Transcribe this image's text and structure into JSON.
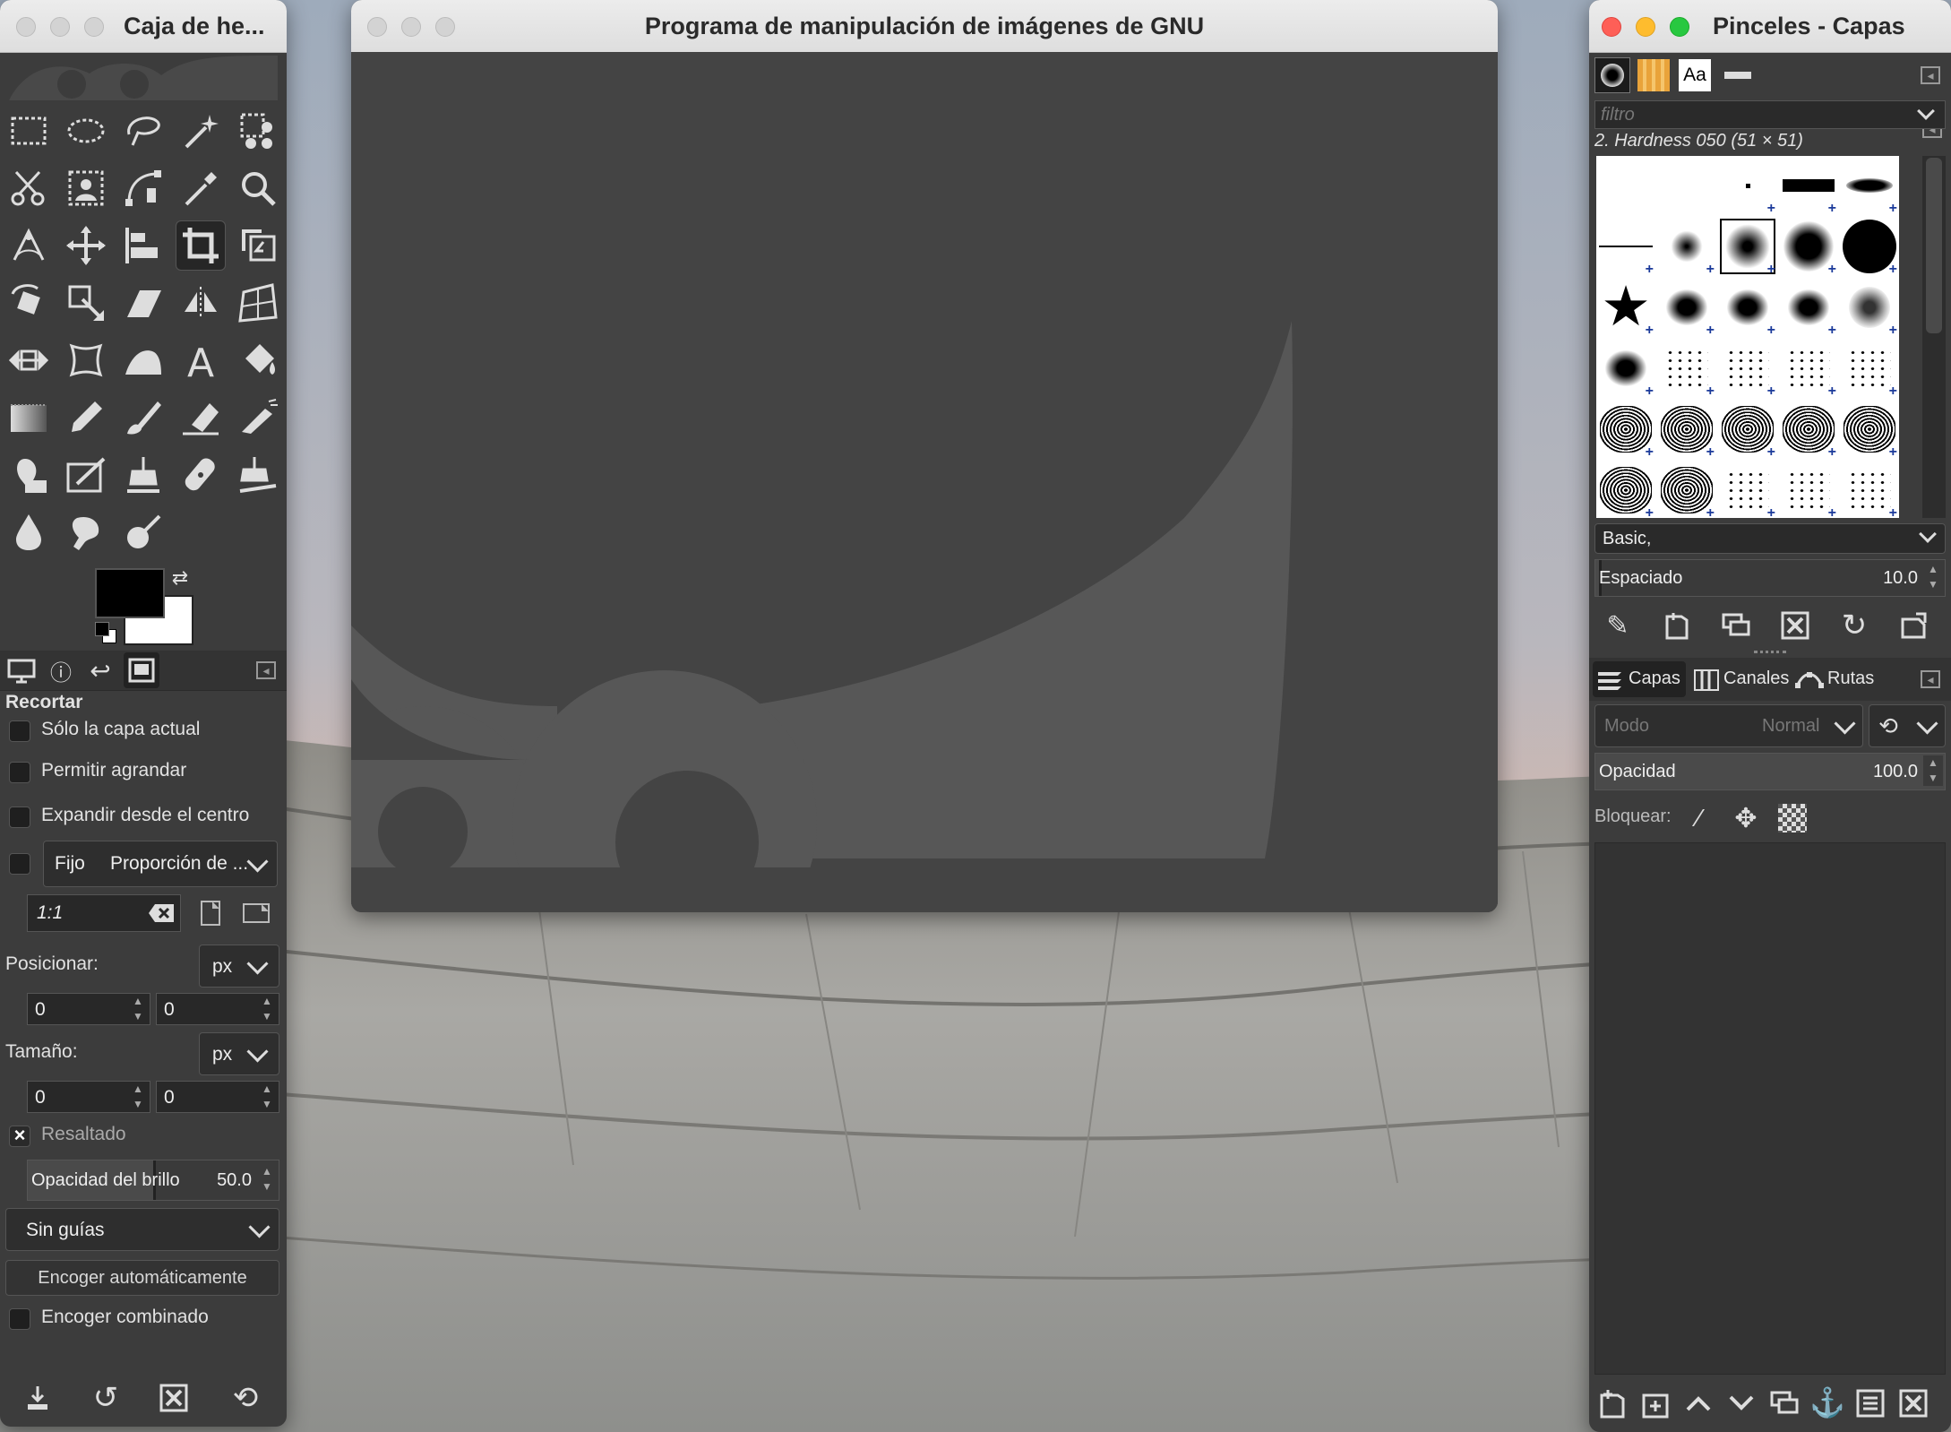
{
  "colors": {
    "accent_blue": "#2c4fa8",
    "panel": "#3c3c3c",
    "canvas": "#444444"
  },
  "toolbox": {
    "title": "Caja de he...",
    "tools": [
      "rect-select",
      "ellipse-select",
      "free-select",
      "fuzzy-select",
      "select-by-color",
      "scissors-select",
      "foreground-select",
      "paths",
      "color-picker",
      "zoom",
      "measure",
      "move",
      "align",
      "crop",
      "unified-transform",
      "rotate",
      "scale",
      "shear",
      "flip",
      "perspective",
      "warp",
      "cage",
      "handle",
      "text",
      "bucket-fill",
      "gradient",
      "pencil",
      "paintbrush",
      "eraser",
      "airbrush",
      "ink",
      "mypaint",
      "clone",
      "heal",
      "perspective-clone",
      "blur",
      "smudge",
      "dodge-burn"
    ],
    "options": {
      "title": "Recortar",
      "only_current_layer": "Sólo la capa actual",
      "allow_growing": "Permitir agrandar",
      "expand_center": "Expandir desde el centro",
      "fixed": "Fijo",
      "fixed_mode": "Proporción de ...",
      "ratio": "1:1",
      "position_label": "Posicionar:",
      "position_unit": "px",
      "pos_x": "0",
      "pos_y": "0",
      "size_label": "Tamaño:",
      "size_unit": "px",
      "size_w": "0",
      "size_h": "0",
      "highlight": "Resaltado",
      "highlight_opacity_label": "Opacidad del brillo",
      "highlight_opacity_value": "50.0",
      "guides": "Sin guías",
      "autoshrink": "Encoger automáticamente",
      "shrink_merged": "Encoger combinado"
    }
  },
  "main": {
    "title": "Programa de manipulación de imágenes de GNU"
  },
  "dock": {
    "title": "Pinceles - Capas",
    "tabs": [
      "Aa"
    ],
    "filter_placeholder": "filtro",
    "brush_name": "2. Hardness 050 (51 × 51)",
    "tag": "Basic,",
    "spacing_label": "Espaciado",
    "spacing_value": "10.0",
    "layer_tabs": {
      "layers": "Capas",
      "channels": "Canales",
      "paths": "Rutas"
    },
    "mode_label": "Modo",
    "mode_value": "Normal",
    "opacity_label": "Opacidad",
    "opacity_value": "100.0",
    "lock_label": "Bloquear:"
  }
}
